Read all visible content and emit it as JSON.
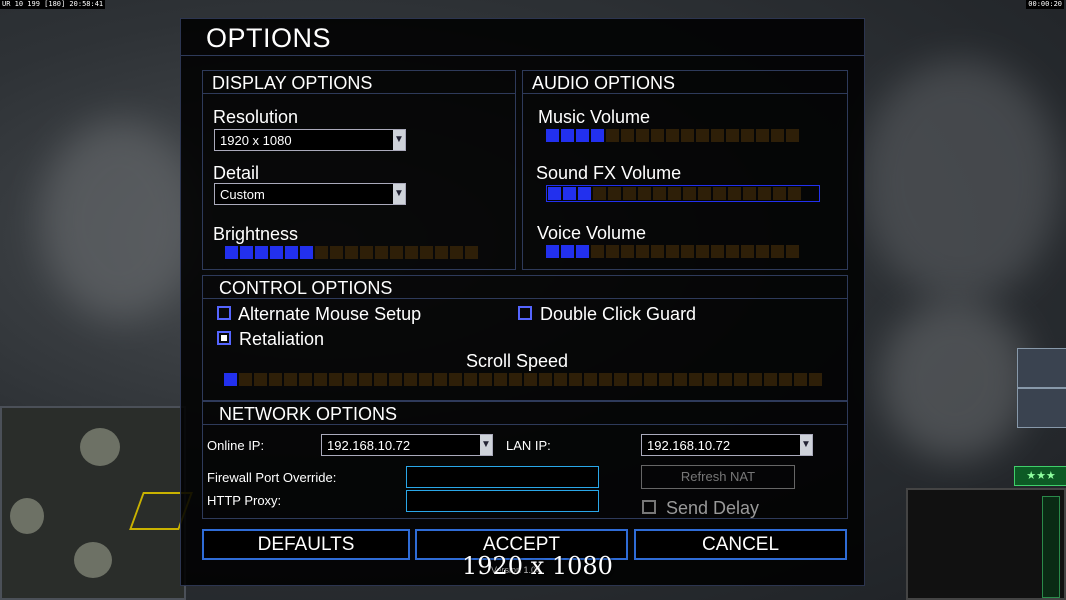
{
  "hud": {
    "top_left": "UR 10 199 [180] 20:58:41",
    "top_right": "00:00:20"
  },
  "dialog": {
    "title": "OPTIONS",
    "display": {
      "title": "DISPLAY OPTIONS",
      "resolution_label": "Resolution",
      "resolution_value": "1920 x 1080",
      "detail_label": "Detail",
      "detail_value": "Custom",
      "brightness_label": "Brightness",
      "brightness_level": 0.35
    },
    "audio": {
      "title": "AUDIO OPTIONS",
      "music_label": "Music Volume",
      "music_level": 0.25,
      "sfx_label": "Sound FX Volume",
      "sfx_level": 0.15,
      "voice_label": "Voice Volume",
      "voice_level": 0.15
    },
    "control": {
      "title": "CONTROL OPTIONS",
      "alternate_mouse_label": "Alternate Mouse Setup",
      "alternate_mouse_checked": false,
      "double_click_label": "Double Click Guard",
      "double_click_checked": false,
      "retaliation_label": "Retaliation",
      "retaliation_checked": true,
      "scroll_speed_label": "Scroll Speed",
      "scroll_speed_level": 0.03
    },
    "network": {
      "title": "NETWORK OPTIONS",
      "online_ip_label": "Online IP:",
      "online_ip_value": "192.168.10.72",
      "lan_ip_label": "LAN IP:",
      "lan_ip_value": "192.168.10.72",
      "firewall_label": "Firewall Port Override:",
      "firewall_value": "",
      "proxy_label": "HTTP Proxy:",
      "proxy_value": "",
      "refresh_nat_label": "Refresh NAT",
      "send_delay_label": "Send Delay",
      "send_delay_checked": false
    },
    "buttons": {
      "defaults": "DEFAULTS",
      "accept": "ACCEPT",
      "cancel": "CANCEL"
    },
    "version": "Version 1.04"
  },
  "overlay_resolution": "1920 x 1080",
  "rank_stars": "★★★"
}
